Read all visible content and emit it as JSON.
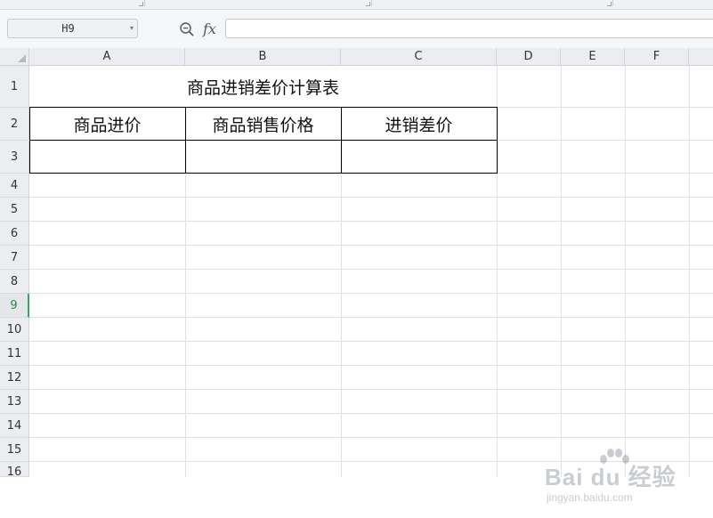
{
  "name_box": {
    "value": "H9"
  },
  "formula_bar": {
    "fx_label": "fx",
    "content": ""
  },
  "columns": [
    "A",
    "B",
    "C",
    "D",
    "E",
    "F"
  ],
  "rows": [
    "1",
    "2",
    "3",
    "4",
    "5",
    "6",
    "7",
    "8",
    "9",
    "10",
    "11",
    "12",
    "13",
    "14",
    "15",
    "16"
  ],
  "active_row": "9",
  "sheet": {
    "title": "商品进销差价计算表",
    "headers": [
      "商品进价",
      "商品销售价格",
      "进销差价"
    ],
    "row3": [
      "",
      "",
      ""
    ]
  },
  "watermark": {
    "text": "Bai du 经验",
    "sub": "jingyan.baidu.com"
  }
}
